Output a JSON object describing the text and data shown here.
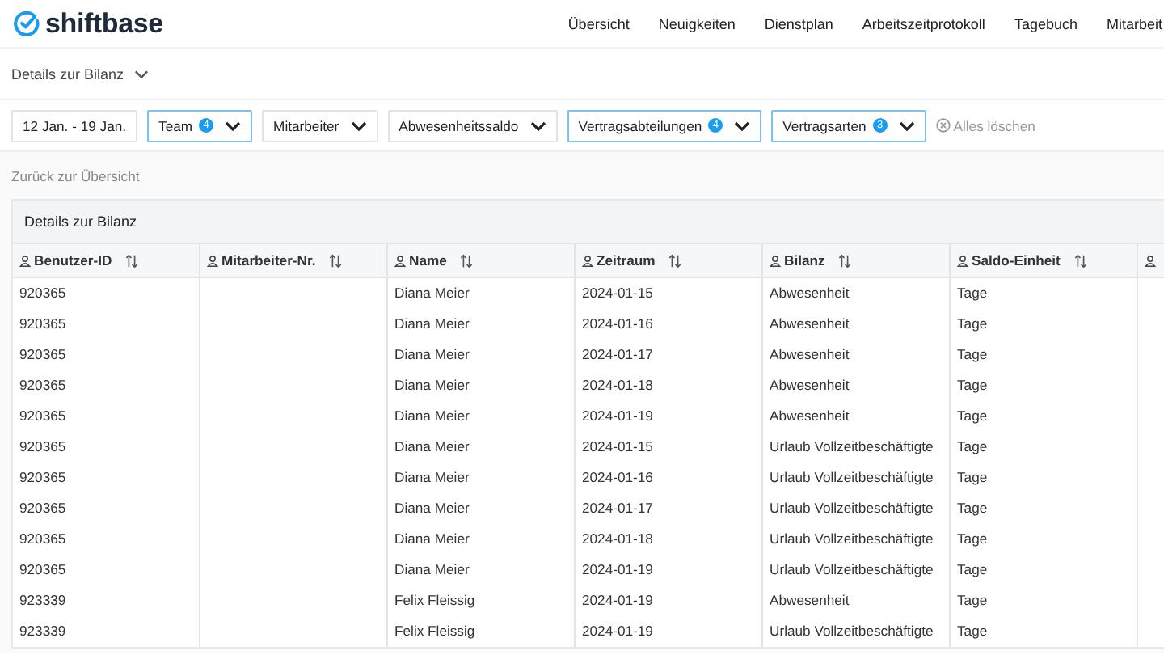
{
  "brand": "shiftbase",
  "nav": [
    "Übersicht",
    "Neuigkeiten",
    "Dienstplan",
    "Arbeitszeitprotokoll",
    "Tagebuch",
    "Mitarbeit"
  ],
  "page_title": "Details zur Bilanz",
  "filters": [
    {
      "label": "12 Jan. - 19 Jan.",
      "kind": "date",
      "active": false
    },
    {
      "label": "Team",
      "kind": "dropdown",
      "active": true,
      "badge": "4"
    },
    {
      "label": "Mitarbeiter",
      "kind": "dropdown",
      "active": false
    },
    {
      "label": "Abwesenheitssaldo",
      "kind": "dropdown",
      "active": false
    },
    {
      "label": "Vertragsabteilungen",
      "kind": "dropdown",
      "active": true,
      "badge": "4"
    },
    {
      "label": "Vertragsarten",
      "kind": "dropdown",
      "active": true,
      "badge": "3"
    }
  ],
  "clear_all": "Alles löschen",
  "back_link": "Zurück zur Übersicht",
  "table": {
    "title": "Details zur Bilanz",
    "columns": [
      "Benutzer-ID",
      "Mitarbeiter-Nr.",
      "Name",
      "Zeitraum",
      "Bilanz",
      "Saldo-Einheit",
      ""
    ],
    "rows": [
      [
        "920365",
        "",
        "Diana Meier",
        "2024-01-15",
        "Abwesenheit",
        "Tage"
      ],
      [
        "920365",
        "",
        "Diana Meier",
        "2024-01-16",
        "Abwesenheit",
        "Tage"
      ],
      [
        "920365",
        "",
        "Diana Meier",
        "2024-01-17",
        "Abwesenheit",
        "Tage"
      ],
      [
        "920365",
        "",
        "Diana Meier",
        "2024-01-18",
        "Abwesenheit",
        "Tage"
      ],
      [
        "920365",
        "",
        "Diana Meier",
        "2024-01-19",
        "Abwesenheit",
        "Tage"
      ],
      [
        "920365",
        "",
        "Diana Meier",
        "2024-01-15",
        "Urlaub Vollzeitbeschäftigte",
        "Tage"
      ],
      [
        "920365",
        "",
        "Diana Meier",
        "2024-01-16",
        "Urlaub Vollzeitbeschäftigte",
        "Tage"
      ],
      [
        "920365",
        "",
        "Diana Meier",
        "2024-01-17",
        "Urlaub Vollzeitbeschäftigte",
        "Tage"
      ],
      [
        "920365",
        "",
        "Diana Meier",
        "2024-01-18",
        "Urlaub Vollzeitbeschäftigte",
        "Tage"
      ],
      [
        "920365",
        "",
        "Diana Meier",
        "2024-01-19",
        "Urlaub Vollzeitbeschäftigte",
        "Tage"
      ],
      [
        "923339",
        "",
        "Felix Fleissig",
        "2024-01-19",
        "Abwesenheit",
        "Tage"
      ],
      [
        "923339",
        "",
        "Felix Fleissig",
        "2024-01-19",
        "Urlaub Vollzeitbeschäftigte",
        "Tage"
      ]
    ]
  }
}
